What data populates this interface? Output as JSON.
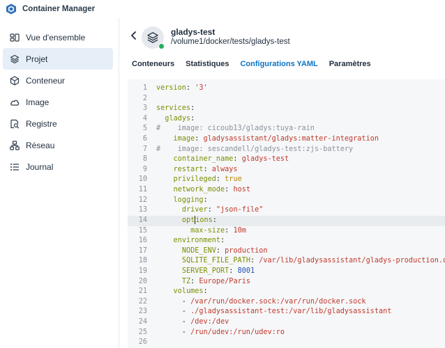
{
  "app": {
    "title": "Container Manager"
  },
  "sidebar": {
    "items": [
      {
        "label": "Vue d'ensemble",
        "icon": "overview-icon"
      },
      {
        "label": "Projet",
        "icon": "project-icon",
        "active": true
      },
      {
        "label": "Conteneur",
        "icon": "container-icon"
      },
      {
        "label": "Image",
        "icon": "cloud-icon"
      },
      {
        "label": "Registre",
        "icon": "registry-search-icon"
      },
      {
        "label": "Réseau",
        "icon": "network-icon"
      },
      {
        "label": "Journal",
        "icon": "log-list-icon"
      }
    ]
  },
  "project": {
    "name": "gladys-test",
    "path": "/volume1/docker/tests/gladys-test",
    "status": "running"
  },
  "tabs": [
    {
      "label": "Conteneurs"
    },
    {
      "label": "Statistiques"
    },
    {
      "label": "Configurations YAML",
      "active": true
    },
    {
      "label": "Paramètres"
    }
  ],
  "editor": {
    "current_line": 14,
    "lines": [
      {
        "n": "1",
        "parts": [
          [
            "k",
            "version"
          ],
          [
            "p",
            ": "
          ],
          [
            "s",
            "'3'"
          ]
        ]
      },
      {
        "n": "2",
        "parts": []
      },
      {
        "n": "3",
        "parts": [
          [
            "k",
            "services"
          ],
          [
            "p",
            ":"
          ]
        ]
      },
      {
        "n": "4",
        "parts": [
          [
            "p",
            "  "
          ],
          [
            "k",
            "gladys"
          ],
          [
            "p",
            ":"
          ]
        ]
      },
      {
        "n": "5",
        "parts": [
          [
            "c",
            "#    image: cicoub13/gladys:tuya-rain"
          ]
        ]
      },
      {
        "n": "6",
        "parts": [
          [
            "p",
            "    "
          ],
          [
            "k",
            "image"
          ],
          [
            "p",
            ": "
          ],
          [
            "s",
            "gladysassistant/gladys:matter-integration"
          ]
        ]
      },
      {
        "n": "7",
        "parts": [
          [
            "c",
            "#    image: sescandell/gladys-test:zjs-battery"
          ]
        ]
      },
      {
        "n": "8",
        "parts": [
          [
            "p",
            "    "
          ],
          [
            "k",
            "container_name"
          ],
          [
            "p",
            ": "
          ],
          [
            "s",
            "gladys-test"
          ]
        ]
      },
      {
        "n": "9",
        "parts": [
          [
            "p",
            "    "
          ],
          [
            "k",
            "restart"
          ],
          [
            "p",
            ": "
          ],
          [
            "s",
            "always"
          ]
        ]
      },
      {
        "n": "10",
        "parts": [
          [
            "p",
            "    "
          ],
          [
            "k",
            "privileged"
          ],
          [
            "p",
            ": "
          ],
          [
            "b",
            "true"
          ]
        ]
      },
      {
        "n": "11",
        "parts": [
          [
            "p",
            "    "
          ],
          [
            "k",
            "network_mode"
          ],
          [
            "p",
            ": "
          ],
          [
            "s",
            "host"
          ]
        ]
      },
      {
        "n": "12",
        "parts": [
          [
            "p",
            "    "
          ],
          [
            "k",
            "logging"
          ],
          [
            "p",
            ":"
          ]
        ]
      },
      {
        "n": "13",
        "parts": [
          [
            "p",
            "      "
          ],
          [
            "k",
            "driver"
          ],
          [
            "p",
            ": "
          ],
          [
            "s",
            "\"json-file\""
          ]
        ]
      },
      {
        "n": "14",
        "parts": [
          [
            "p",
            "      "
          ],
          [
            "k",
            "opt"
          ],
          [
            "caret",
            ""
          ],
          [
            "k",
            "ions"
          ],
          [
            "p",
            ":"
          ]
        ]
      },
      {
        "n": "15",
        "parts": [
          [
            "p",
            "        "
          ],
          [
            "k",
            "max-size"
          ],
          [
            "p",
            ": "
          ],
          [
            "s",
            "10m"
          ]
        ]
      },
      {
        "n": "16",
        "parts": [
          [
            "p",
            "    "
          ],
          [
            "k",
            "environment"
          ],
          [
            "p",
            ":"
          ]
        ]
      },
      {
        "n": "17",
        "parts": [
          [
            "p",
            "      "
          ],
          [
            "k",
            "NODE_ENV"
          ],
          [
            "p",
            ": "
          ],
          [
            "s",
            "production"
          ]
        ]
      },
      {
        "n": "18",
        "parts": [
          [
            "p",
            "      "
          ],
          [
            "k",
            "SQLITE_FILE_PATH"
          ],
          [
            "p",
            ": "
          ],
          [
            "s",
            "/var/lib/gladysassistant/gladys-production.db"
          ]
        ]
      },
      {
        "n": "19",
        "parts": [
          [
            "p",
            "      "
          ],
          [
            "k",
            "SERVER_PORT"
          ],
          [
            "p",
            ": "
          ],
          [
            "n",
            "8001"
          ]
        ]
      },
      {
        "n": "20",
        "parts": [
          [
            "p",
            "      "
          ],
          [
            "k",
            "TZ"
          ],
          [
            "p",
            ": "
          ],
          [
            "s",
            "Europe/Paris"
          ]
        ]
      },
      {
        "n": "21",
        "parts": [
          [
            "p",
            "    "
          ],
          [
            "k",
            "volumes"
          ],
          [
            "p",
            ":"
          ]
        ]
      },
      {
        "n": "22",
        "parts": [
          [
            "p",
            "      - "
          ],
          [
            "s",
            "/var/run/docker.sock:/var/run/docker.sock"
          ]
        ]
      },
      {
        "n": "23",
        "parts": [
          [
            "p",
            "      - "
          ],
          [
            "s",
            "./gladysassistant-test:/var/lib/gladysassistant"
          ]
        ]
      },
      {
        "n": "24",
        "parts": [
          [
            "p",
            "      - "
          ],
          [
            "s",
            "/dev:/dev"
          ]
        ]
      },
      {
        "n": "25",
        "parts": [
          [
            "p",
            "      - "
          ],
          [
            "s",
            "/run/udev:/run/udev:ro"
          ]
        ]
      },
      {
        "n": "26",
        "parts": []
      }
    ]
  },
  "colors": {
    "accent": "#0a74c6",
    "active_nav_bg": "#e6eef7",
    "status_running": "#27ae60"
  }
}
